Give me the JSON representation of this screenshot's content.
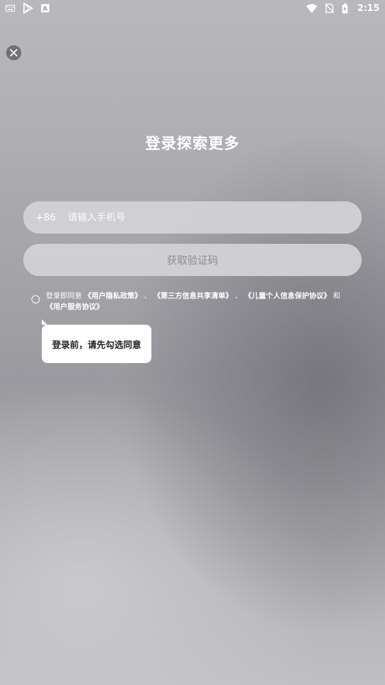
{
  "status_bar": {
    "time": "2:15",
    "left_icons": [
      "keyboard-icon",
      "play-store-icon",
      "a-notification-icon"
    ],
    "right_icons": [
      "wifi-icon",
      "no-sim-icon",
      "battery-icon"
    ]
  },
  "header": {
    "close_icon": "close-icon"
  },
  "main": {
    "title": "登录探索更多",
    "phone": {
      "country_code": "+86",
      "placeholder": "请输入手机号",
      "value": ""
    },
    "code_button": "获取验证码",
    "agreement": {
      "prefix": "登录即同意",
      "link_privacy": "《用户隐私政策》",
      "sep1": "、",
      "link_third_party": "《第三方信息共享清单》",
      "sep2": "、",
      "link_children": "《儿童个人信息保护协议》",
      "and": "和",
      "link_service": "《用户服务协议》"
    },
    "tooltip": "登录前，请先勾选同意"
  }
}
